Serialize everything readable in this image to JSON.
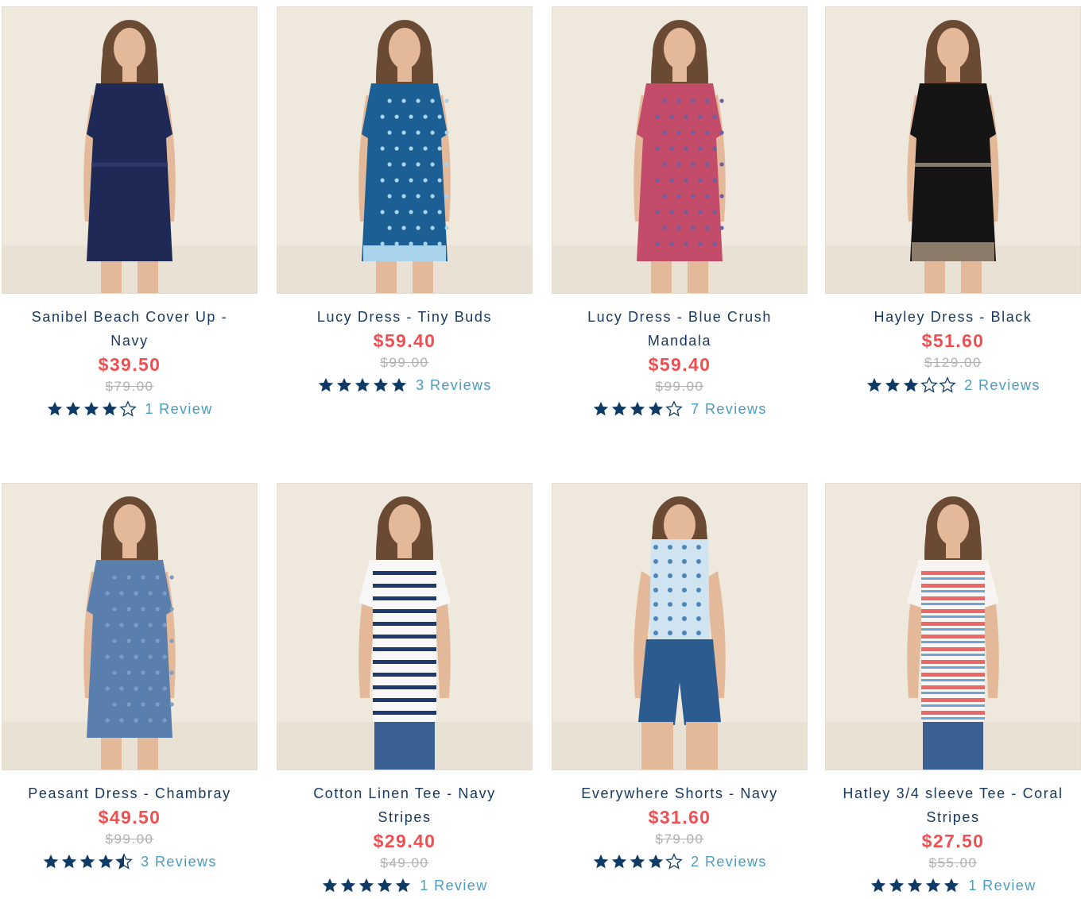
{
  "colors": {
    "name": "#17375e",
    "sale_price": "#ef4f51",
    "original_price": "#b0b0b0",
    "star": "#0e3a63",
    "reviews_link": "#4a9cbf",
    "photo_bg": "#ece4d8"
  },
  "products": [
    {
      "name_line1": "Sanibel Beach Cover Up -",
      "name_line2": "Navy",
      "price": "$39.50",
      "original_price": "$79.00",
      "rating": 4,
      "reviews": "1 Review",
      "garment": "navy-dress-icon",
      "garment_color": "#1e2a55",
      "accent_color": "#2b3a6b"
    },
    {
      "name_line1": "Lucy Dress - Tiny Buds",
      "name_line2": "",
      "price": "$59.40",
      "original_price": "$99.00",
      "rating": 5,
      "reviews": "3 Reviews",
      "garment": "blue-print-dress-icon",
      "garment_color": "#1b5f95",
      "accent_color": "#a9d4ec"
    },
    {
      "name_line1": "Lucy Dress - Blue Crush",
      "name_line2": "Mandala",
      "price": "$59.40",
      "original_price": "$99.00",
      "rating": 4,
      "reviews": "7 Reviews",
      "garment": "pink-print-dress-icon",
      "garment_color": "#c24c6a",
      "accent_color": "#6c5fa3"
    },
    {
      "name_line1": "Hayley Dress - Black",
      "name_line2": "",
      "price": "$51.60",
      "original_price": "$129.00",
      "rating": 3,
      "reviews": "2 Reviews",
      "garment": "black-dress-icon",
      "garment_color": "#151515",
      "accent_color": "#8a7b6a"
    },
    {
      "name_line1": "Peasant Dress - Chambray",
      "name_line2": "",
      "price": "$49.50",
      "original_price": "$99.00",
      "rating": 4.5,
      "reviews": "3 Reviews",
      "garment": "chambray-dress-icon",
      "garment_color": "#5b7fad",
      "accent_color": "#7f9cc4"
    },
    {
      "name_line1": "Cotton Linen Tee - Navy",
      "name_line2": "Stripes",
      "price": "$29.40",
      "original_price": "$49.00",
      "rating": 5,
      "reviews": "1 Review",
      "garment": "striped-tee-icon",
      "garment_color": "#f7f7f7",
      "accent_color": "#1f3a6e"
    },
    {
      "name_line1": "Everywhere Shorts - Navy",
      "name_line2": "",
      "price": "$31.60",
      "original_price": "$79.00",
      "rating": 4,
      "reviews": "2 Reviews",
      "garment": "shorts-icon",
      "garment_color": "#2c5b8f",
      "accent_color": "#cfe3f1"
    },
    {
      "name_line1": "Hatley 3/4 sleeve Tee - Coral",
      "name_line2": "Stripes",
      "price": "$27.50",
      "original_price": "$55.00",
      "rating": 5,
      "reviews": "1 Review",
      "garment": "coral-striped-tee-icon",
      "garment_color": "#f8f4f2",
      "accent_color": "#e86a6a"
    }
  ]
}
